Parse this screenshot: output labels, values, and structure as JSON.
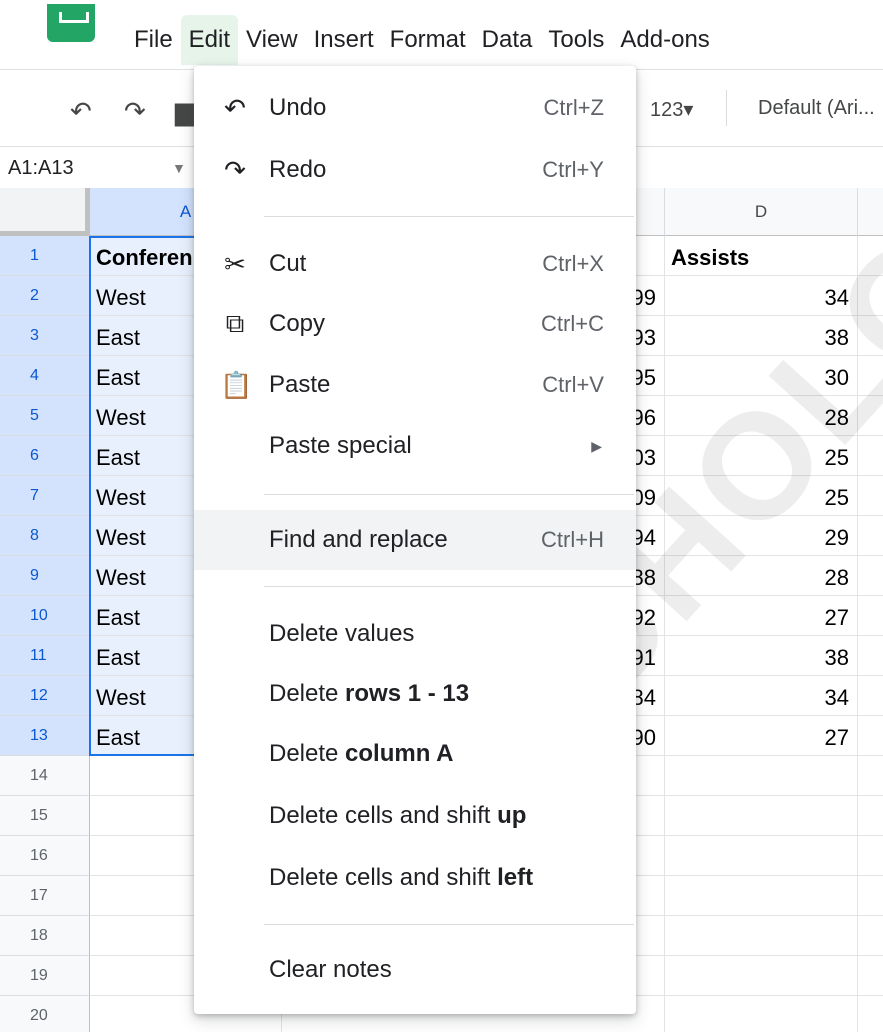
{
  "menubar": {
    "items": [
      {
        "label": "File"
      },
      {
        "label": "Edit",
        "active": true
      },
      {
        "label": "View"
      },
      {
        "label": "Insert"
      },
      {
        "label": "Format"
      },
      {
        "label": "Data"
      },
      {
        "label": "Tools"
      },
      {
        "label": "Add-ons"
      }
    ]
  },
  "toolbar": {
    "number_format": "123▾",
    "font": "Default (Ari..."
  },
  "namebox": {
    "value": "A1:A13"
  },
  "columns": [
    "A",
    "D"
  ],
  "rows": [
    {
      "num": "1",
      "a": "Conferen",
      "d": "Assists",
      "partial": ""
    },
    {
      "num": "2",
      "a": "West",
      "d": "34",
      "partial": "99"
    },
    {
      "num": "3",
      "a": "East",
      "d": "38",
      "partial": "93"
    },
    {
      "num": "4",
      "a": "East",
      "d": "30",
      "partial": "95"
    },
    {
      "num": "5",
      "a": "West",
      "d": "28",
      "partial": "96"
    },
    {
      "num": "6",
      "a": "East",
      "d": "25",
      "partial": "03"
    },
    {
      "num": "7",
      "a": "West",
      "d": "25",
      "partial": "09"
    },
    {
      "num": "8",
      "a": "West",
      "d": "29",
      "partial": "94"
    },
    {
      "num": "9",
      "a": "West",
      "d": "28",
      "partial": "88"
    },
    {
      "num": "10",
      "a": "East",
      "d": "27",
      "partial": "92"
    },
    {
      "num": "11",
      "a": "East",
      "d": "38",
      "partial": "91"
    },
    {
      "num": "12",
      "a": "West",
      "d": "34",
      "partial": "84"
    },
    {
      "num": "13",
      "a": "East",
      "d": "27",
      "partial": "90"
    },
    {
      "num": "14",
      "a": "",
      "d": "",
      "partial": ""
    },
    {
      "num": "15",
      "a": "",
      "d": "",
      "partial": ""
    },
    {
      "num": "16",
      "a": "",
      "d": "",
      "partial": ""
    },
    {
      "num": "17",
      "a": "",
      "d": "",
      "partial": ""
    },
    {
      "num": "18",
      "a": "",
      "d": "",
      "partial": ""
    },
    {
      "num": "19",
      "a": "",
      "d": "",
      "partial": ""
    },
    {
      "num": "20",
      "a": "",
      "d": "",
      "partial": ""
    }
  ],
  "edit_menu": {
    "undo": {
      "label": "Undo",
      "shortcut": "Ctrl+Z",
      "icon": "undo-icon"
    },
    "redo": {
      "label": "Redo",
      "shortcut": "Ctrl+Y",
      "icon": "redo-icon"
    },
    "cut": {
      "label": "Cut",
      "shortcut": "Ctrl+X",
      "icon": "scissors-icon"
    },
    "copy": {
      "label": "Copy",
      "shortcut": "Ctrl+C",
      "icon": "copy-icon"
    },
    "paste": {
      "label": "Paste",
      "shortcut": "Ctrl+V",
      "icon": "clipboard-icon"
    },
    "paste_special": {
      "label": "Paste special"
    },
    "find_replace": {
      "label": "Find and replace",
      "shortcut": "Ctrl+H"
    },
    "delete_values": {
      "label": "Delete values"
    },
    "delete_rows": {
      "prefix": "Delete ",
      "bold": "rows 1 - 13"
    },
    "delete_column": {
      "prefix": "Delete ",
      "bold": "column A"
    },
    "delete_shift_up": {
      "prefix": "Delete cells and shift ",
      "bold": "up"
    },
    "delete_shift_left": {
      "prefix": "Delete cells and shift ",
      "bold": "left"
    },
    "clear_notes": {
      "label": "Clear notes"
    }
  },
  "colors": {
    "accent": "#1a73e8",
    "selection_fill": "#e8f0fe",
    "menu_active": "#e6f4ea",
    "logo": "#23a566"
  }
}
